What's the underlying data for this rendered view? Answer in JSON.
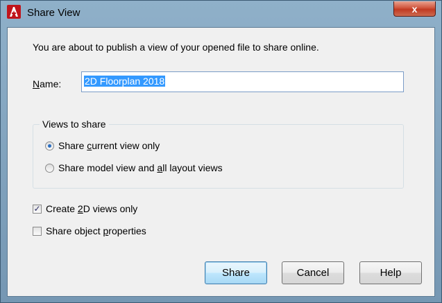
{
  "window": {
    "title": "Share View",
    "close_glyph": "x"
  },
  "dialog": {
    "intro_text": "You are about to publish a view of your opened file to share online.",
    "name_label": "Name:",
    "name_value": "2D Floorplan 2018",
    "views_group_label": "Views to share",
    "views_options": [
      {
        "label": "Share current view only",
        "checked": true
      },
      {
        "label": "Share model view and all layout views",
        "checked": false
      }
    ],
    "checkboxes": [
      {
        "label": "Create 2D views only",
        "checked": true
      },
      {
        "label": "Share object properties",
        "checked": false
      }
    ],
    "buttons": {
      "share": "Share",
      "cancel": "Cancel",
      "help": "Help"
    }
  },
  "colors": {
    "accent": "#3399ff",
    "close": "#c13a22",
    "app_icon": "#c0141b"
  }
}
